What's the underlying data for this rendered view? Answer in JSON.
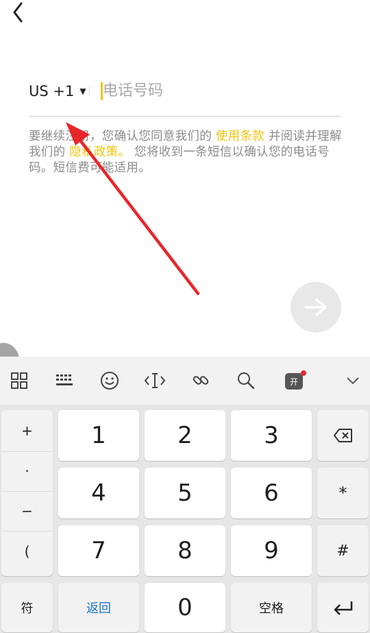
{
  "header": {
    "back_icon": "chevron-left-icon"
  },
  "phone": {
    "country_code": "US +1",
    "dropdown_icon": "caret-down-icon",
    "placeholder": "电话号码"
  },
  "terms": {
    "part1": "要继续注册，您确认您同意我们的",
    "link1": "使用条款",
    "part2": "并阅读并理解我们的",
    "link2": "隐私政策。",
    "part3": "您将收到一条短信以确认您的电话号码。短信费可能适用。"
  },
  "next_icon": "arrow-right-icon",
  "colors": {
    "accent": "#f4c20d",
    "link": "#f0c40f",
    "annotation_arrow": "#e8262a"
  },
  "keyboard": {
    "toolbar_icons": [
      "grid-icon",
      "keyboard-icon",
      "emoji-icon",
      "text-cursor-icon",
      "link-icon",
      "search-icon",
      "app-icon",
      "chevron-down-icon"
    ],
    "side_keys": [
      "+",
      "·",
      "−",
      "("
    ],
    "digits": [
      "1",
      "2",
      "3",
      "4",
      "5",
      "6",
      "7",
      "8",
      "9",
      "0"
    ],
    "symbols": {
      "star": "*",
      "hash": "#"
    },
    "backspace_icon": "backspace-icon",
    "symbol_key": "符",
    "return_key": "返回",
    "space_key": "空格",
    "enter_icon": "enter-icon"
  }
}
